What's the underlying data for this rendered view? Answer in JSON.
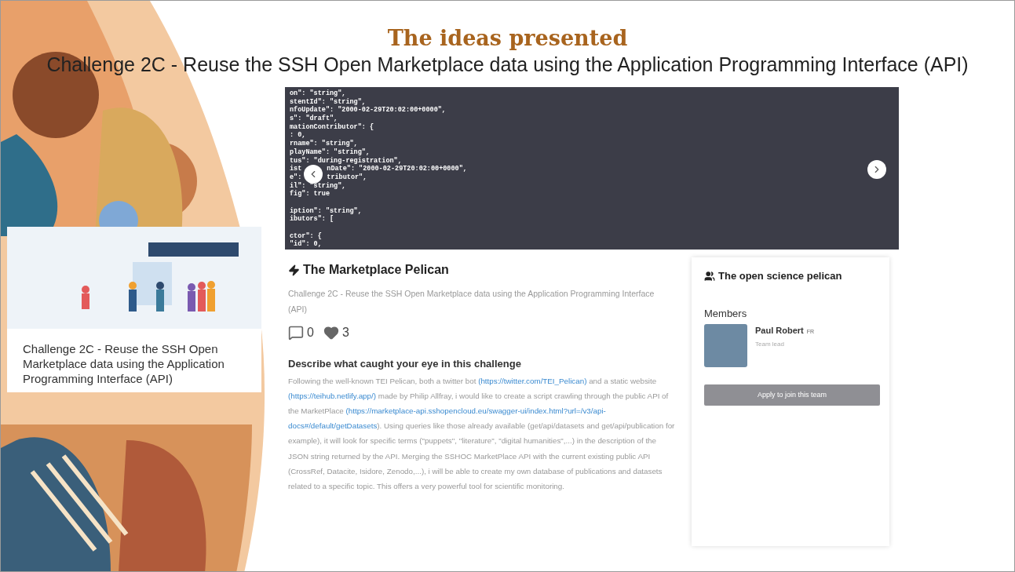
{
  "slide": {
    "title": "The ideas presented",
    "subtitle": "Challenge 2C - Reuse the SSH Open Marketplace data using the Application Programming Interface (API)"
  },
  "challenge_card": {
    "caption": "Challenge 2C - Reuse the SSH Open Marketplace data using the Application Programming Interface (API)"
  },
  "code_preview": {
    "blocks": [
      [
        [
          "on\": \"string\","
        ],
        [
          "stentId\": \"string\","
        ],
        [
          "nfoUpdate\": \"2000-02-29T20:02:00+0000\","
        ],
        [
          "s\": \"draft\","
        ],
        [
          "mationContributor\": {"
        ],
        [
          ": 0,"
        ],
        [
          "rname\": \"string\","
        ],
        [
          "playName\": \"string\","
        ],
        [
          "tus\": \"during-registration\","
        ],
        [
          "ist",
          "nDate\": \"2000-02-29T20:02:00+0000\","
        ],
        [
          "e\":",
          "tributor\","
        ],
        [
          "il\": \"string\","
        ],
        [
          "fig\": true"
        ]
      ],
      [
        [
          "iption\": \"string\","
        ],
        [
          "ibutors\": ["
        ]
      ],
      [
        [
          "ctor\": {"
        ],
        [
          "\"id\": 0,"
        ]
      ]
    ]
  },
  "idea": {
    "title": "The Marketplace Pelican",
    "challenge": "Challenge 2C - Reuse the SSH Open Marketplace data using the Application Programming Interface (API)",
    "comments": "0",
    "likes": "3",
    "question": "Describe what caught your eye in this challenge",
    "answer": [
      {
        "text": "Following the well-known TEI Pelican, both a twitter bot ",
        "link": false
      },
      {
        "text": "(https://twitter.com/TEI_Pelican)",
        "link": true
      },
      {
        "text": " and a static website ",
        "link": false
      },
      {
        "text": "(https://teihub.netlify.app/)",
        "link": true
      },
      {
        "text": " made by Philip Allfray, i would like to create a script crawling through the public API of the MarketPlace ",
        "link": false
      },
      {
        "text": "(https://marketplace-api.sshopencloud.eu/swagger-ui/index.html?url=/v3/api-",
        "link": true
      },
      {
        "text": "docs#/default/getDatasets",
        "link": true
      },
      {
        "text": "). Using queries like those already available (get/api/datasets and get/api/publication for example), it will look for specific terms (\"puppets\", \"literature\", \"digital humanities\",...) in the description of the JSON string returned by the API. Merging the SSHOC MarketPlace API with the current existing public API (CrossRef, Datacite, Isidore, Zenodo,...), i will be able to create my own database of publications and datasets related to a specific topic. This offers a very powerful tool for scientific monitoring.",
        "link": false
      }
    ]
  },
  "team": {
    "name": "The open science pelican",
    "members_heading": "Members",
    "members": [
      {
        "name": "Paul Robert",
        "country": "FR",
        "role": "Team lead"
      }
    ],
    "button": "Apply to join this team"
  }
}
